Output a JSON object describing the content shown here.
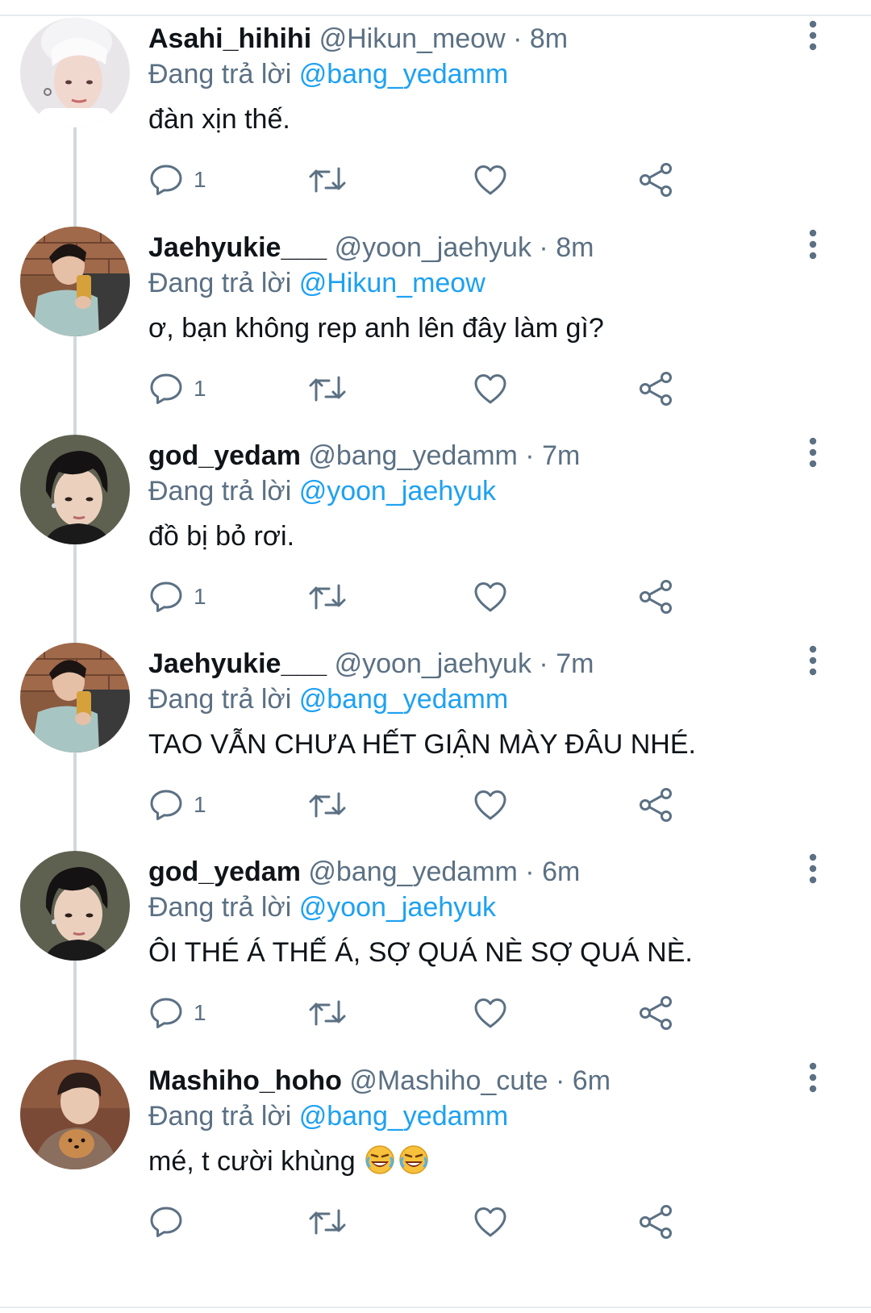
{
  "replying_prefix": "Đang trả lời",
  "separator": "·",
  "colors": {
    "accent": "#1da1f2",
    "secondary_text": "#5b7083",
    "primary_text": "#0f1419",
    "thread_line": "#cfd9de"
  },
  "icons": {
    "reply": "reply-icon",
    "retweet": "retweet-icon",
    "like": "heart-icon",
    "share": "share-icon",
    "more": "more-vertical-icon"
  },
  "tweets": [
    {
      "name": "Asahi_hihihi",
      "handle": "@Hikun_meow",
      "time": "8m",
      "replying_to": "@bang_yedamm",
      "text": "đàn xịn thế.",
      "reply_count": "1",
      "avatar": "asahi",
      "emoji": ""
    },
    {
      "name": "Jaehyukie___",
      "handle": "@yoon_jaehyuk",
      "time": "8m",
      "replying_to": "@Hikun_meow",
      "text": "ơ, bạn không rep anh lên đây làm gì?",
      "reply_count": "1",
      "avatar": "jaehyuk",
      "emoji": ""
    },
    {
      "name": "god_yedam",
      "handle": "@bang_yedamm",
      "time": "7m",
      "replying_to": "@yoon_jaehyuk",
      "text": "đồ bị bỏ rơi.",
      "reply_count": "1",
      "avatar": "yedam",
      "emoji": ""
    },
    {
      "name": "Jaehyukie___",
      "handle": "@yoon_jaehyuk",
      "time": "7m",
      "replying_to": "@bang_yedamm",
      "text": "TAO VẪN CHƯA HẾT GIẬN MÀY ĐÂU NHÉ.",
      "reply_count": "1",
      "avatar": "jaehyuk",
      "emoji": ""
    },
    {
      "name": "god_yedam",
      "handle": "@bang_yedamm",
      "time": "6m",
      "replying_to": "@yoon_jaehyuk",
      "text": "ÔI THÉ Á THẾ Á, SỢ QUÁ NÈ SỢ QUÁ NÈ.",
      "reply_count": "1",
      "avatar": "yedam",
      "emoji": ""
    },
    {
      "name": "Mashiho_hoho",
      "handle": "@Mashiho_cute",
      "time": "6m",
      "replying_to": "@bang_yedamm",
      "text": "mé, t cười khùng",
      "reply_count": "",
      "avatar": "mashiho",
      "emoji": "rolling-on-floor-laughing-emoji"
    }
  ]
}
